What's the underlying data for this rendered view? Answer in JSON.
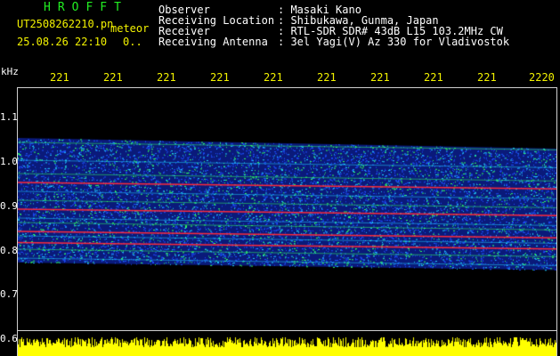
{
  "header": {
    "brand": "HROFFT",
    "filename": "UT2508262210.pn",
    "meteor_label": "meteor",
    "datetime": "25.08.26 22:10",
    "status": "0..",
    "fields": [
      {
        "label": "Observer",
        "value": ": Masaki Kano"
      },
      {
        "label": "Receiving Location",
        "value": ": Shibukawa, Gunma, Japan"
      },
      {
        "label": "Receiver",
        "value": ": RTL-SDR SDR# 43dB L15 103.2MHz CW"
      },
      {
        "label": "Receiving Antenna",
        "value": ": 3el Yagi(V) Az 330 for Vladivostok"
      }
    ]
  },
  "axes": {
    "y_unit": "kHz",
    "y_ticks": [
      {
        "label": "1.1",
        "value": 1.1
      },
      {
        "label": "1.0",
        "value": 1.0
      },
      {
        "label": "0.9",
        "value": 0.9
      },
      {
        "label": "0.8",
        "value": 0.8
      },
      {
        "label": "0.7",
        "value": 0.7
      },
      {
        "label": "0.6",
        "value": 0.6
      }
    ],
    "x_ticks": [
      "221",
      "221",
      "221",
      "221",
      "221",
      "221",
      "221",
      "221",
      "221",
      "2220"
    ]
  },
  "spectrogram": {
    "freq_range_khz": [
      0.6,
      1.14
    ],
    "band_low_khz": 0.77,
    "band_high_khz": 1.05,
    "red_traces_khz": [
      0.95,
      0.89,
      0.84,
      0.815
    ],
    "colors": {
      "background": "#000000",
      "band_base": "#0a1a7a",
      "band_noise": "#1e50ff",
      "cyan": "#20d0ff",
      "green": "#30ff60",
      "red": "#ff2a3a",
      "yellow": "#ffff00",
      "axis_text": "#ffffff",
      "tick_text": "#f2f200",
      "brand_text": "#22ee22"
    }
  }
}
